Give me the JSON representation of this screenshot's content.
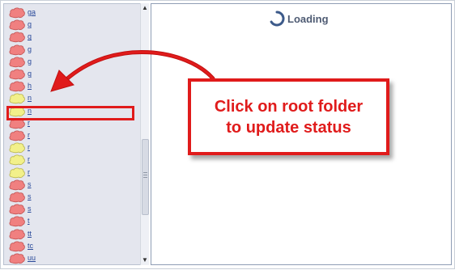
{
  "tree": {
    "items": [
      {
        "label": "ga",
        "status": "red"
      },
      {
        "label": "g",
        "status": "red"
      },
      {
        "label": "g",
        "status": "red"
      },
      {
        "label": "g",
        "status": "red"
      },
      {
        "label": "g",
        "status": "red"
      },
      {
        "label": "g",
        "status": "red"
      },
      {
        "label": "h",
        "status": "red"
      },
      {
        "label": "n",
        "status": "yellow"
      },
      {
        "label": "n",
        "status": "yellow"
      },
      {
        "label": "r",
        "status": "red"
      },
      {
        "label": "r",
        "status": "red"
      },
      {
        "label": "r",
        "status": "yellow"
      },
      {
        "label": "r",
        "status": "yellow"
      },
      {
        "label": "r",
        "status": "yellow"
      },
      {
        "label": "s",
        "status": "red"
      },
      {
        "label": "s",
        "status": "red"
      },
      {
        "label": "s",
        "status": "red"
      },
      {
        "label": "t",
        "status": "red"
      },
      {
        "label": "tt",
        "status": "red"
      },
      {
        "label": "tc",
        "status": "red"
      },
      {
        "label": "uu",
        "status": "red"
      }
    ]
  },
  "content": {
    "loading_text": "Loading"
  },
  "callout": {
    "line1": "Click on root folder",
    "line2": "to update status"
  },
  "colors": {
    "red_status": "#f08080",
    "yellow_status": "#f2f08a",
    "annotation": "#e01b1b"
  }
}
